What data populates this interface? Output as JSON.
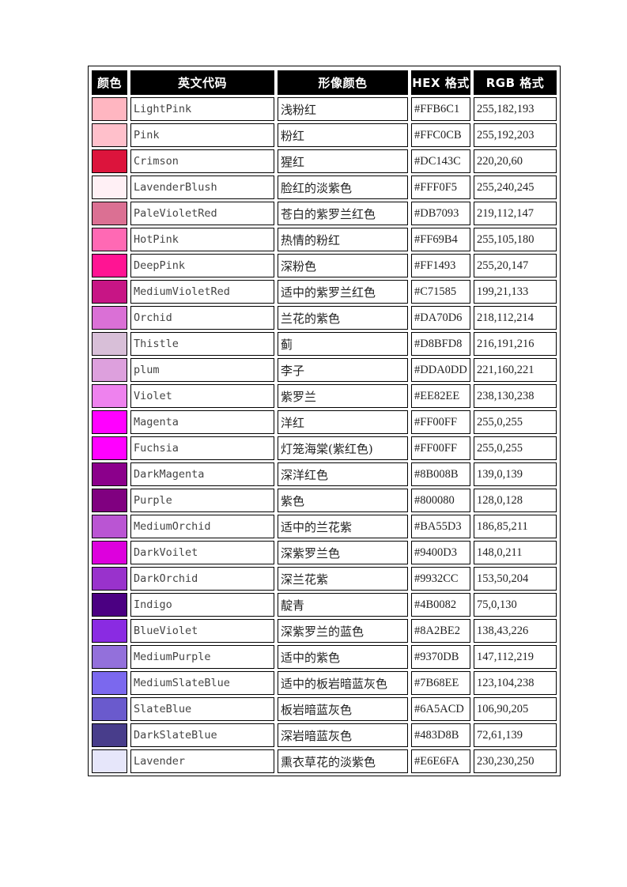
{
  "table": {
    "headers": [
      "颜色",
      "英文代码",
      "形像颜色",
      "HEX 格式",
      "RGB 格式"
    ],
    "rows": [
      {
        "swatch": "#FFB6C1",
        "en": "LightPink",
        "cn": "浅粉红",
        "hex": "#FFB6C1",
        "rgb": "255,182,193"
      },
      {
        "swatch": "#FFC0CB",
        "en": "Pink",
        "cn": "粉红",
        "hex": "#FFC0CB",
        "rgb": "255,192,203"
      },
      {
        "swatch": "#DC143C",
        "en": "Crimson",
        "cn": "猩红",
        "hex": "#DC143C",
        "rgb": "220,20,60"
      },
      {
        "swatch": "#FFF0F5",
        "en": "LavenderBlush",
        "cn": "脸红的淡紫色",
        "hex": "#FFF0F5",
        "rgb": "255,240,245"
      },
      {
        "swatch": "#DB7093",
        "en": "PaleVioletRed",
        "cn": "苍白的紫罗兰红色",
        "hex": "#DB7093",
        "rgb": "219,112,147"
      },
      {
        "swatch": "#FF69B4",
        "en": "HotPink",
        "cn": "热情的粉红",
        "hex": "#FF69B4",
        "rgb": "255,105,180"
      },
      {
        "swatch": "#FF1493",
        "en": "DeepPink",
        "cn": "深粉色",
        "hex": "#FF1493",
        "rgb": "255,20,147"
      },
      {
        "swatch": "#C71585",
        "en": "MediumVioletRed",
        "cn": "适中的紫罗兰红色",
        "hex": "#C71585",
        "rgb": "199,21,133"
      },
      {
        "swatch": "#DA70D6",
        "en": "Orchid",
        "cn": "兰花的紫色",
        "hex": "#DA70D6",
        "rgb": "218,112,214"
      },
      {
        "swatch": "#D8BFD8",
        "en": "Thistle",
        "cn": "蓟",
        "hex": "#D8BFD8",
        "rgb": "216,191,216"
      },
      {
        "swatch": "#DDA0DD",
        "en": "plum",
        "cn": "李子",
        "hex": "#DDA0DD",
        "rgb": "221,160,221"
      },
      {
        "swatch": "#EE82EE",
        "en": "Violet",
        "cn": "紫罗兰",
        "hex": "#EE82EE",
        "rgb": "238,130,238"
      },
      {
        "swatch": "#FF00FF",
        "en": "Magenta",
        "cn": "洋红",
        "hex": "#FF00FF",
        "rgb": "255,0,255"
      },
      {
        "swatch": "#FF00FF",
        "en": "Fuchsia",
        "cn": "灯笼海棠(紫红色)",
        "hex": "#FF00FF",
        "rgb": "255,0,255"
      },
      {
        "swatch": "#8B008B",
        "en": "DarkMagenta",
        "cn": "深洋红色",
        "hex": "#8B008B",
        "rgb": "139,0,139"
      },
      {
        "swatch": "#800080",
        "en": "Purple",
        "cn": "紫色",
        "hex": "#800080",
        "rgb": "128,0,128"
      },
      {
        "swatch": "#BA55D3",
        "en": "MediumOrchid",
        "cn": "适中的兰花紫",
        "hex": "#BA55D3",
        "rgb": "186,85,211"
      },
      {
        "swatch": "#DD00DD",
        "en": "DarkVoilet",
        "cn": "深紫罗兰色",
        "hex": "#9400D3",
        "rgb": "148,0,211"
      },
      {
        "swatch": "#9932CC",
        "en": "DarkOrchid",
        "cn": "深兰花紫",
        "hex": "#9932CC",
        "rgb": "153,50,204"
      },
      {
        "swatch": "#4B0082",
        "en": "Indigo",
        "cn": "靛青",
        "hex": "#4B0082",
        "rgb": "75,0,130"
      },
      {
        "swatch": "#8A2BE2",
        "en": "BlueViolet",
        "cn": "深紫罗兰的蓝色",
        "hex": "#8A2BE2",
        "rgb": "138,43,226"
      },
      {
        "swatch": "#9370DB",
        "en": "MediumPurple",
        "cn": "适中的紫色",
        "hex": "#9370DB",
        "rgb": "147,112,219"
      },
      {
        "swatch": "#7B68EE",
        "en": "MediumSlateBlue",
        "cn": "适中的板岩暗蓝灰色",
        "hex": "#7B68EE",
        "rgb": "123,104,238"
      },
      {
        "swatch": "#6A5ACD",
        "en": "SlateBlue",
        "cn": "板岩暗蓝灰色",
        "hex": "#6A5ACD",
        "rgb": "106,90,205"
      },
      {
        "swatch": "#483D8B",
        "en": "DarkSlateBlue",
        "cn": "深岩暗蓝灰色",
        "hex": "#483D8B",
        "rgb": "72,61,139"
      },
      {
        "swatch": "#E6E6FA",
        "en": "Lavender",
        "cn": "熏衣草花的淡紫色",
        "hex": "#E6E6FA",
        "rgb": "230,230,250"
      }
    ]
  }
}
